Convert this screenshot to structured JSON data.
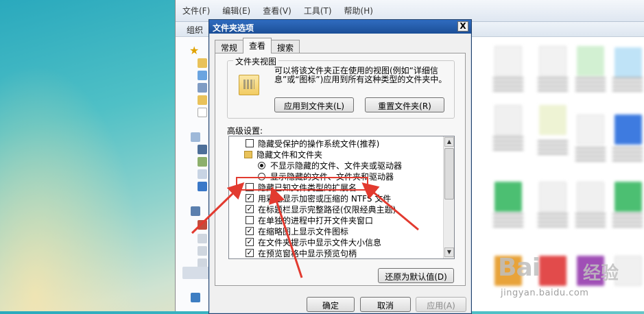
{
  "explorer": {
    "menu": [
      "文件(F)",
      "编辑(E)",
      "查看(V)",
      "工具(T)",
      "帮助(H)"
    ],
    "toolbar_label": "组织"
  },
  "dialog": {
    "title": "文件夹选项",
    "close_glyph": "X",
    "tabs": [
      "常规",
      "查看",
      "搜索"
    ],
    "active_tab": "查看",
    "folder_views": {
      "title": "文件夹视图",
      "description": "可以将该文件夹正在使用的视图(例如“详细信息”或“图标”)应用到所有这种类型的文件夹中。",
      "apply_button": "应用到文件夹(L)",
      "reset_button": "重置文件夹(R)"
    },
    "advanced_label": "高级设置:",
    "settings": [
      {
        "type": "checkbox",
        "checked": false,
        "label": "隐藏受保护的操作系统文件(推荐)"
      },
      {
        "type": "folder",
        "label": "隐藏文件和文件夹"
      },
      {
        "type": "radio",
        "checked": true,
        "label": "不显示隐藏的文件、文件夹或驱动器"
      },
      {
        "type": "radio",
        "checked": false,
        "label": "显示隐藏的文件、文件夹和驱动器"
      },
      {
        "type": "checkbox",
        "checked": false,
        "label": "隐藏已知文件类型的扩展名",
        "highlighted": true
      },
      {
        "type": "checkbox",
        "checked": true,
        "label": "用彩色显示加密或压缩的 NTFS 文件"
      },
      {
        "type": "checkbox",
        "checked": true,
        "label": "在标题栏显示完整路径(仅限经典主题)"
      },
      {
        "type": "checkbox",
        "checked": false,
        "label": "在单独的进程中打开文件夹窗口"
      },
      {
        "type": "checkbox",
        "checked": true,
        "label": "在缩略图上显示文件图标"
      },
      {
        "type": "checkbox",
        "checked": true,
        "label": "在文件夹提示中显示文件大小信息"
      },
      {
        "type": "checkbox",
        "checked": true,
        "label": "在预览窗格中显示预览句柄"
      }
    ],
    "restore_button": "还原为默认值(D)",
    "ok_button": "确定",
    "cancel_button": "取消",
    "apply_button": "应用(A)"
  },
  "watermark": {
    "brand": "Bai",
    "brand_cn": "经验",
    "domain": "jingyan.baidu.com"
  },
  "colors": {
    "titlebar": "#1c4f97",
    "annotation": "#e23a2f"
  }
}
